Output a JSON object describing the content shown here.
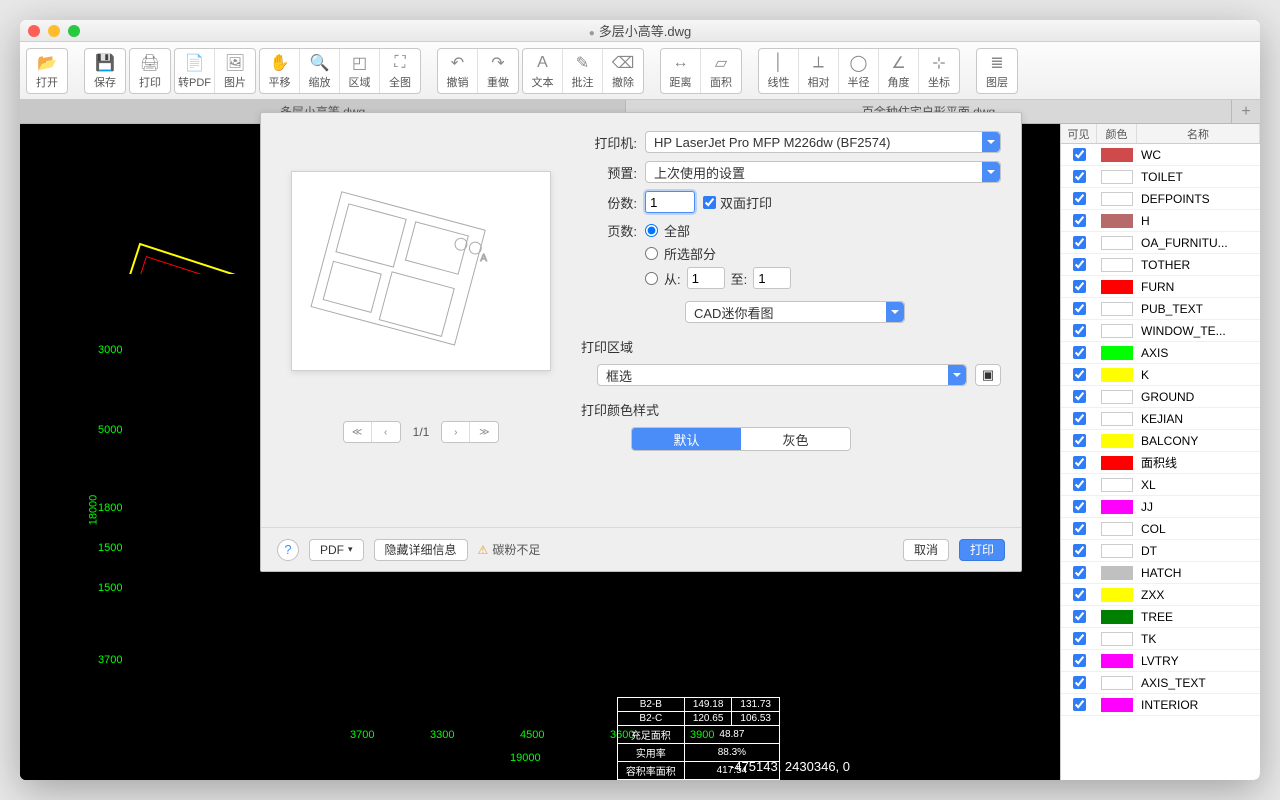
{
  "window": {
    "title": "多层小高等.dwg"
  },
  "toolbar": [
    {
      "label": "打开",
      "icon": "📂"
    },
    {
      "label": "保存",
      "icon": "💾"
    },
    {
      "label": "打印",
      "icon": "🖨"
    },
    {
      "label": "转PDF",
      "icon": "📄"
    },
    {
      "label": "图片",
      "icon": "🖼"
    },
    {
      "label": "平移",
      "icon": "✋"
    },
    {
      "label": "缩放",
      "icon": "🔍"
    },
    {
      "label": "区域",
      "icon": "◰"
    },
    {
      "label": "全图",
      "icon": "⛶"
    },
    {
      "label": "撤销",
      "icon": "↶"
    },
    {
      "label": "重做",
      "icon": "↷"
    },
    {
      "label": "文本",
      "icon": "A"
    },
    {
      "label": "批注",
      "icon": "✎"
    },
    {
      "label": "撤除",
      "icon": "⌫"
    },
    {
      "label": "距离",
      "icon": "↔"
    },
    {
      "label": "面积",
      "icon": "▱"
    },
    {
      "label": "线性",
      "icon": "│"
    },
    {
      "label": "相对",
      "icon": "⟂"
    },
    {
      "label": "半径",
      "icon": "◯"
    },
    {
      "label": "角度",
      "icon": "∠"
    },
    {
      "label": "坐标",
      "icon": "⊹"
    },
    {
      "label": "图层",
      "icon": "≣"
    }
  ],
  "toolbarGroups": [
    [
      0
    ],
    [
      1
    ],
    [
      2
    ],
    [
      3,
      4
    ],
    [
      5,
      6,
      7,
      8
    ],
    [
      9,
      10
    ],
    [
      11,
      12,
      13
    ],
    [
      14,
      15
    ],
    [
      16,
      17,
      18,
      19,
      20
    ],
    [
      21
    ]
  ],
  "tabs": [
    {
      "label": "多层小高等.dwg",
      "active": true
    },
    {
      "label": "百余种住宅户形平面.dwg",
      "active": false
    }
  ],
  "coord": "-475143, 2430346, 0",
  "layers": {
    "headers": {
      "visible": "可见",
      "color": "颜色",
      "name": "名称"
    },
    "items": [
      {
        "name": "WC",
        "color": "#cf4b4b"
      },
      {
        "name": "TOILET",
        "color": "#ffffff"
      },
      {
        "name": "DEFPOINTS",
        "color": "#ffffff"
      },
      {
        "name": "H",
        "color": "#b76a6a"
      },
      {
        "name": "OA_FURNITU...",
        "color": "#ffffff"
      },
      {
        "name": "TOTHER",
        "color": "#ffffff"
      },
      {
        "name": "FURN",
        "color": "#ff0000"
      },
      {
        "name": "PUB_TEXT",
        "color": "#ffffff"
      },
      {
        "name": "WINDOW_TE...",
        "color": "#ffffff"
      },
      {
        "name": "AXIS",
        "color": "#00ff00"
      },
      {
        "name": "K",
        "color": "#ffff00"
      },
      {
        "name": "GROUND",
        "color": "#ffffff"
      },
      {
        "name": "KEJIAN",
        "color": "#ffffff"
      },
      {
        "name": "BALCONY",
        "color": "#ffff00"
      },
      {
        "name": "面积线",
        "color": "#ff0000"
      },
      {
        "name": "XL",
        "color": "#ffffff"
      },
      {
        "name": "JJ",
        "color": "#ff00ff"
      },
      {
        "name": "COL",
        "color": "#ffffff"
      },
      {
        "name": "DT",
        "color": "#ffffff"
      },
      {
        "name": "HATCH",
        "color": "#c0c0c0"
      },
      {
        "name": "ZXX",
        "color": "#ffff00"
      },
      {
        "name": "TREE",
        "color": "#008000"
      },
      {
        "name": "TK",
        "color": "#ffffff"
      },
      {
        "name": "LVTRY",
        "color": "#ff00ff"
      },
      {
        "name": "AXIS_TEXT",
        "color": "#ffffff"
      },
      {
        "name": "INTERIOR",
        "color": "#ff00ff"
      }
    ]
  },
  "dialog": {
    "labels": {
      "printer": "打印机:",
      "preset": "预置:",
      "copies": "份数:",
      "duplex": "双面打印",
      "pages": "页数:",
      "all": "全部",
      "selected": "所选部分",
      "from": "从:",
      "to": "至:",
      "printArea": "打印区域",
      "colorStyle": "打印颜色样式",
      "default": "默认",
      "gray": "灰色",
      "hideDetails": "隐藏详细信息",
      "lowToner": "碳粉不足",
      "cancel": "取消",
      "print": "打印",
      "pdf": "PDF"
    },
    "printer": "HP LaserJet Pro MFP M226dw (BF2574)",
    "preset": "上次使用的设置",
    "copies": "1",
    "pageFrom": "1",
    "pageTo": "1",
    "app": "CAD迷你看图",
    "areaMode": "框选",
    "pager": "1/1"
  },
  "cadTable": {
    "rows": [
      [
        "B2-B",
        "149.18",
        "131.73"
      ],
      [
        "B2-C",
        "120.65",
        "106.53"
      ],
      [
        "充足面积",
        "48.87",
        ""
      ],
      [
        "实用率",
        "88.3%",
        ""
      ],
      [
        "容积率面积",
        "417.54",
        ""
      ]
    ]
  },
  "dims": {
    "left": [
      "3000",
      "5000",
      "18000",
      "1800",
      "1500",
      "1500",
      "3700"
    ],
    "bottom": [
      "3700",
      "3300",
      "4500",
      "3600",
      "3900"
    ],
    "total": "19000"
  }
}
